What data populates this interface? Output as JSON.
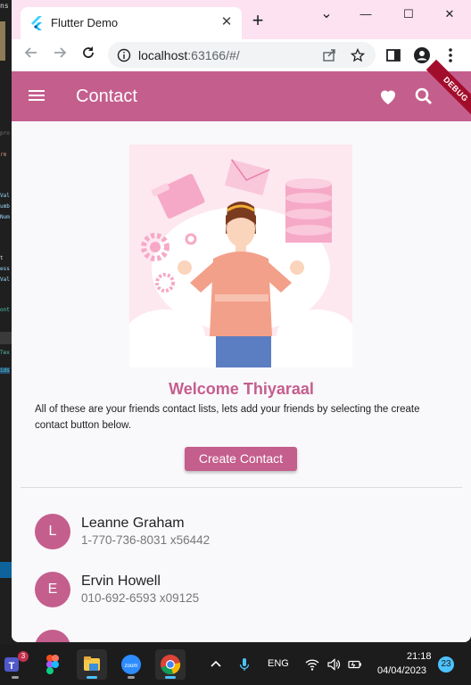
{
  "background_editor": {
    "snippets": [
      "ns",
      "pro",
      "rm",
      "Val",
      "umb",
      "Num",
      "t",
      "ess",
      "Val",
      "ont",
      "Tex",
      "ids"
    ]
  },
  "browser": {
    "tab_title": "Flutter Demo",
    "url_host": "localhost",
    "url_rest": ":63166/#/",
    "window_controls": {
      "minimize": "—",
      "maximize": "☐",
      "close": "✕",
      "dropdown": "⌄"
    },
    "new_tab_symbol": "+",
    "tab_close_symbol": "✕"
  },
  "app": {
    "title": "Contact",
    "debug_label": "DEBUG",
    "accent_color": "#c45e8d"
  },
  "main": {
    "welcome": "Welcome Thiyaraal",
    "description": "All of these are your friends contact lists, lets add your friends by selecting the create contact button below.",
    "create_button": "Create Contact"
  },
  "contacts": [
    {
      "initial": "L",
      "name": "Leanne Graham",
      "phone": "1-770-736-8031 x56442"
    },
    {
      "initial": "E",
      "name": "Ervin Howell",
      "phone": "010-692-6593 x09125"
    }
  ],
  "taskbar": {
    "language": "ENG",
    "time": "21:18",
    "date": "04/04/2023",
    "notifications": "23",
    "teams_badge": "3",
    "apps": [
      "teams-icon",
      "figma-icon",
      "file-explorer-icon",
      "zoom-icon",
      "chrome-icon"
    ]
  }
}
